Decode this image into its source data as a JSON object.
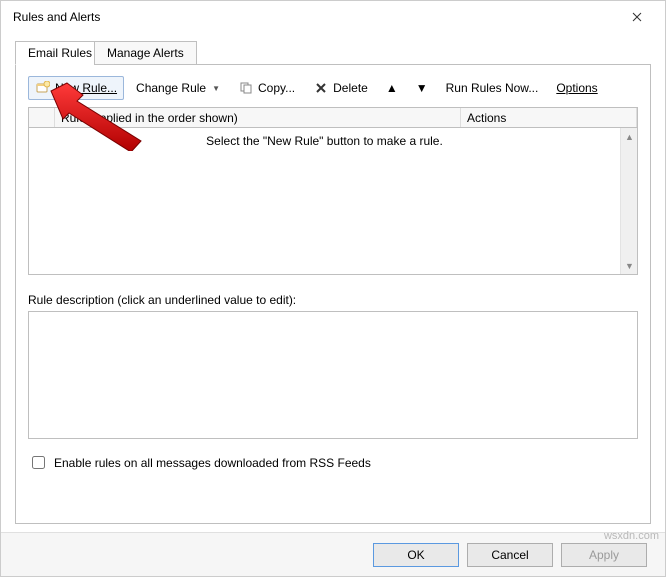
{
  "window": {
    "title": "Rules and Alerts"
  },
  "tabs": {
    "email": {
      "label": "Email Rules"
    },
    "alerts": {
      "label": "Manage Alerts"
    }
  },
  "toolbar": {
    "newRule": "New Rule...",
    "changeRule": "Change Rule",
    "copy": "Copy...",
    "delete": "Delete",
    "runRulesNow": "Run Rules Now...",
    "options": "Options"
  },
  "columns": {
    "rule": "Rule (applied in the order shown)",
    "actions": "Actions"
  },
  "placeholder": "Select the \"New Rule\" button to make a rule.",
  "descLabel": "Rule description (click an underlined value to edit):",
  "rss": {
    "label": "Enable rules on all messages downloaded from RSS Feeds"
  },
  "buttons": {
    "ok": "OK",
    "cancel": "Cancel",
    "apply": "Apply"
  },
  "watermark": "wsxdn.com"
}
